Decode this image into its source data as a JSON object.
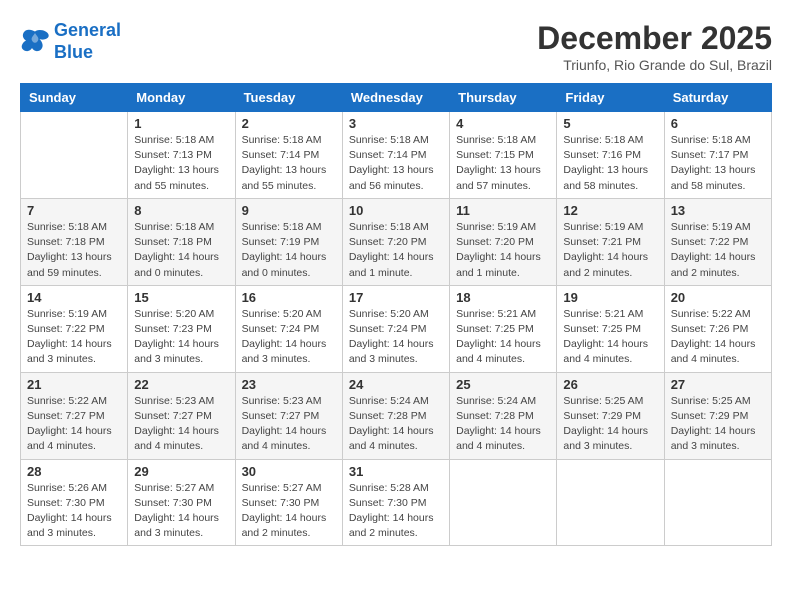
{
  "header": {
    "logo_line1": "General",
    "logo_line2": "Blue",
    "month": "December 2025",
    "location": "Triunfo, Rio Grande do Sul, Brazil"
  },
  "weekdays": [
    "Sunday",
    "Monday",
    "Tuesday",
    "Wednesday",
    "Thursday",
    "Friday",
    "Saturday"
  ],
  "weeks": [
    [
      {
        "day": "",
        "info": ""
      },
      {
        "day": "1",
        "info": "Sunrise: 5:18 AM\nSunset: 7:13 PM\nDaylight: 13 hours\nand 55 minutes."
      },
      {
        "day": "2",
        "info": "Sunrise: 5:18 AM\nSunset: 7:14 PM\nDaylight: 13 hours\nand 55 minutes."
      },
      {
        "day": "3",
        "info": "Sunrise: 5:18 AM\nSunset: 7:14 PM\nDaylight: 13 hours\nand 56 minutes."
      },
      {
        "day": "4",
        "info": "Sunrise: 5:18 AM\nSunset: 7:15 PM\nDaylight: 13 hours\nand 57 minutes."
      },
      {
        "day": "5",
        "info": "Sunrise: 5:18 AM\nSunset: 7:16 PM\nDaylight: 13 hours\nand 58 minutes."
      },
      {
        "day": "6",
        "info": "Sunrise: 5:18 AM\nSunset: 7:17 PM\nDaylight: 13 hours\nand 58 minutes."
      }
    ],
    [
      {
        "day": "7",
        "info": "Sunrise: 5:18 AM\nSunset: 7:18 PM\nDaylight: 13 hours\nand 59 minutes."
      },
      {
        "day": "8",
        "info": "Sunrise: 5:18 AM\nSunset: 7:18 PM\nDaylight: 14 hours\nand 0 minutes."
      },
      {
        "day": "9",
        "info": "Sunrise: 5:18 AM\nSunset: 7:19 PM\nDaylight: 14 hours\nand 0 minutes."
      },
      {
        "day": "10",
        "info": "Sunrise: 5:18 AM\nSunset: 7:20 PM\nDaylight: 14 hours\nand 1 minute."
      },
      {
        "day": "11",
        "info": "Sunrise: 5:19 AM\nSunset: 7:20 PM\nDaylight: 14 hours\nand 1 minute."
      },
      {
        "day": "12",
        "info": "Sunrise: 5:19 AM\nSunset: 7:21 PM\nDaylight: 14 hours\nand 2 minutes."
      },
      {
        "day": "13",
        "info": "Sunrise: 5:19 AM\nSunset: 7:22 PM\nDaylight: 14 hours\nand 2 minutes."
      }
    ],
    [
      {
        "day": "14",
        "info": "Sunrise: 5:19 AM\nSunset: 7:22 PM\nDaylight: 14 hours\nand 3 minutes."
      },
      {
        "day": "15",
        "info": "Sunrise: 5:20 AM\nSunset: 7:23 PM\nDaylight: 14 hours\nand 3 minutes."
      },
      {
        "day": "16",
        "info": "Sunrise: 5:20 AM\nSunset: 7:24 PM\nDaylight: 14 hours\nand 3 minutes."
      },
      {
        "day": "17",
        "info": "Sunrise: 5:20 AM\nSunset: 7:24 PM\nDaylight: 14 hours\nand 3 minutes."
      },
      {
        "day": "18",
        "info": "Sunrise: 5:21 AM\nSunset: 7:25 PM\nDaylight: 14 hours\nand 4 minutes."
      },
      {
        "day": "19",
        "info": "Sunrise: 5:21 AM\nSunset: 7:25 PM\nDaylight: 14 hours\nand 4 minutes."
      },
      {
        "day": "20",
        "info": "Sunrise: 5:22 AM\nSunset: 7:26 PM\nDaylight: 14 hours\nand 4 minutes."
      }
    ],
    [
      {
        "day": "21",
        "info": "Sunrise: 5:22 AM\nSunset: 7:27 PM\nDaylight: 14 hours\nand 4 minutes."
      },
      {
        "day": "22",
        "info": "Sunrise: 5:23 AM\nSunset: 7:27 PM\nDaylight: 14 hours\nand 4 minutes."
      },
      {
        "day": "23",
        "info": "Sunrise: 5:23 AM\nSunset: 7:27 PM\nDaylight: 14 hours\nand 4 minutes."
      },
      {
        "day": "24",
        "info": "Sunrise: 5:24 AM\nSunset: 7:28 PM\nDaylight: 14 hours\nand 4 minutes."
      },
      {
        "day": "25",
        "info": "Sunrise: 5:24 AM\nSunset: 7:28 PM\nDaylight: 14 hours\nand 4 minutes."
      },
      {
        "day": "26",
        "info": "Sunrise: 5:25 AM\nSunset: 7:29 PM\nDaylight: 14 hours\nand 3 minutes."
      },
      {
        "day": "27",
        "info": "Sunrise: 5:25 AM\nSunset: 7:29 PM\nDaylight: 14 hours\nand 3 minutes."
      }
    ],
    [
      {
        "day": "28",
        "info": "Sunrise: 5:26 AM\nSunset: 7:30 PM\nDaylight: 14 hours\nand 3 minutes."
      },
      {
        "day": "29",
        "info": "Sunrise: 5:27 AM\nSunset: 7:30 PM\nDaylight: 14 hours\nand 3 minutes."
      },
      {
        "day": "30",
        "info": "Sunrise: 5:27 AM\nSunset: 7:30 PM\nDaylight: 14 hours\nand 2 minutes."
      },
      {
        "day": "31",
        "info": "Sunrise: 5:28 AM\nSunset: 7:30 PM\nDaylight: 14 hours\nand 2 minutes."
      },
      {
        "day": "",
        "info": ""
      },
      {
        "day": "",
        "info": ""
      },
      {
        "day": "",
        "info": ""
      }
    ]
  ]
}
